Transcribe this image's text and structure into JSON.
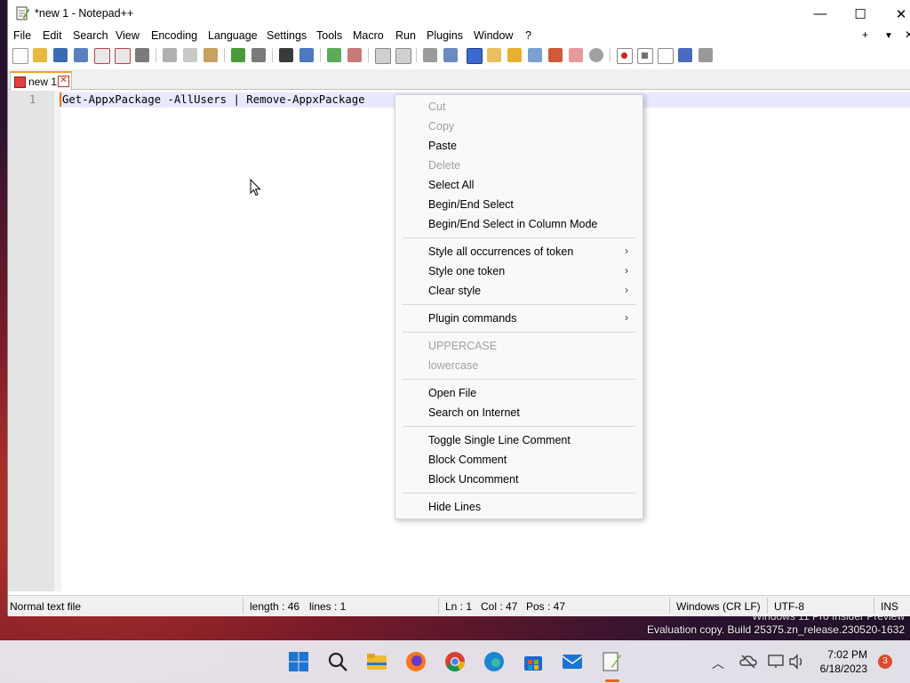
{
  "window": {
    "title": "*new 1 - Notepad++",
    "minimize_glyph": "—",
    "maximize_glyph": "☐",
    "close_glyph": "✕"
  },
  "menu": [
    "File",
    "Edit",
    "Search",
    "View",
    "Encoding",
    "Language",
    "Settings",
    "Tools",
    "Macro",
    "Run",
    "Plugins",
    "Window",
    "?"
  ],
  "menu_right": {
    "add": "+",
    "dropdown": "▼",
    "close": "✕"
  },
  "tab": {
    "label": "new 1",
    "close_glyph": "✕"
  },
  "editor": {
    "line_number": "1",
    "line_text": "Get-AppxPackage -AllUsers | Remove-AppxPackage"
  },
  "context_menu": {
    "items": [
      {
        "label": "Cut",
        "disabled": true
      },
      {
        "label": "Copy",
        "disabled": true
      },
      {
        "label": "Paste",
        "disabled": false
      },
      {
        "label": "Delete",
        "disabled": true
      },
      {
        "label": "Select All",
        "disabled": false
      },
      {
        "label": "Begin/End Select",
        "disabled": false
      },
      {
        "label": "Begin/End Select in Column Mode",
        "disabled": false
      },
      {
        "label": "Style all occurrences of token",
        "disabled": false,
        "submenu": true
      },
      {
        "label": "Style one token",
        "disabled": false,
        "submenu": true
      },
      {
        "label": "Clear style",
        "disabled": false,
        "submenu": true
      },
      {
        "label": "Plugin commands",
        "disabled": false,
        "submenu": true
      },
      {
        "label": "UPPERCASE",
        "disabled": true
      },
      {
        "label": "lowercase",
        "disabled": true
      },
      {
        "label": "Open File",
        "disabled": false
      },
      {
        "label": "Search on Internet",
        "disabled": false
      },
      {
        "label": "Toggle Single Line Comment",
        "disabled": false
      },
      {
        "label": "Block Comment",
        "disabled": false
      },
      {
        "label": "Block Uncomment",
        "disabled": false
      },
      {
        "label": "Hide Lines",
        "disabled": false
      }
    ],
    "submenu_arrow": "›"
  },
  "status": {
    "file_type": "Normal text file",
    "length": "length : 46",
    "lines": "lines : 1",
    "ln": "Ln : 1",
    "col": "Col : 47",
    "pos": "Pos : 47",
    "eol": "Windows (CR LF)",
    "encoding": "UTF-8",
    "mode": "INS"
  },
  "desktop": {
    "watermark_line1": "Windows 11 Pro Insider Preview",
    "watermark_line2": "Evaluation copy. Build 25375.zn_release.230520-1632"
  },
  "taskbar": {
    "time": "7:02 PM",
    "date": "6/18/2023",
    "notifications": "3",
    "tray_arrow": "︿"
  },
  "colors": {
    "accent": "#f0a030",
    "caret": "#f07000",
    "current_line": "#e8e8ff"
  }
}
